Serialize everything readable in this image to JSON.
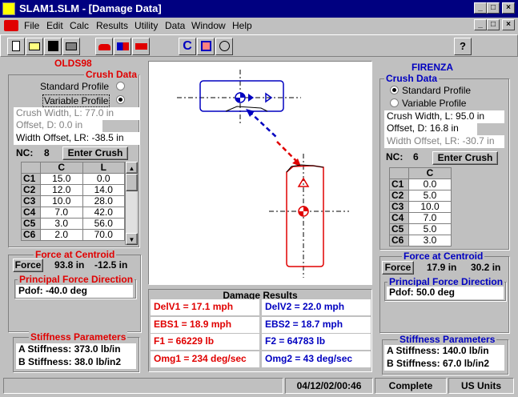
{
  "window": {
    "title": "SLAM1.SLM - [Damage Data]",
    "controls": {
      "minimize": "_",
      "maximize": "□",
      "close": "×"
    }
  },
  "menu": [
    "File",
    "Edit",
    "Calc",
    "Results",
    "Utility",
    "Data",
    "Window",
    "Help"
  ],
  "toolbar": {
    "crush_button": "C",
    "help_button": "?"
  },
  "left": {
    "vehicle": "OLDS98",
    "crush_data_title": "Crush Data",
    "standard_profile": "Standard Profile",
    "variable_profile": "Variable Profile",
    "selected_profile": "variable",
    "crush_width": "Crush Width, L:   77.0 in",
    "offset": "Offset, D:     0.0 in",
    "width_offset": "Width Offset, LR:  -38.5 in",
    "nc_label": "NC:",
    "nc_value": "8",
    "enter_crush": "Enter Crush",
    "table": {
      "headers": [
        "C",
        "L"
      ],
      "rows": [
        {
          "label": "C1",
          "c": "15.0",
          "l": "0.0"
        },
        {
          "label": "C2",
          "c": "12.0",
          "l": "14.0"
        },
        {
          "label": "C3",
          "c": "10.0",
          "l": "28.0"
        },
        {
          "label": "C4",
          "c": "7.0",
          "l": "42.0"
        },
        {
          "label": "C5",
          "c": "3.0",
          "l": "56.0"
        },
        {
          "label": "C6",
          "c": "2.0",
          "l": "70.0"
        }
      ]
    },
    "force_title": "Force at Centroid",
    "force_button": "Force",
    "force_x": "93.8 in",
    "force_y": "-12.5 in",
    "pdof_title": "Principal Force Direction",
    "pdof": "Pdof:  -40.0 deg",
    "stiffness_title": "Stiffness Parameters",
    "a_stiffness": "A Stiffness:  373.0 lb/in",
    "b_stiffness": "B Stiffness:   38.0 lb/in2"
  },
  "right": {
    "vehicle": "FIRENZA",
    "crush_data_title": "Crush Data",
    "standard_profile": "Standard Profile",
    "variable_profile": "Variable Profile",
    "selected_profile": "standard",
    "crush_width": "Crush Width, L:    95.0 in",
    "offset": "Offset, D:     16.8 in",
    "width_offset": "Width Offset, LR:  -30.7 in",
    "nc_label": "NC:",
    "nc_value": "6",
    "enter_crush": "Enter Crush",
    "table": {
      "headers": [
        "C"
      ],
      "rows": [
        {
          "label": "C1",
          "c": "0.0"
        },
        {
          "label": "C2",
          "c": "5.0"
        },
        {
          "label": "C3",
          "c": "10.0"
        },
        {
          "label": "C4",
          "c": "7.0"
        },
        {
          "label": "C5",
          "c": "5.0"
        },
        {
          "label": "C6",
          "c": "3.0"
        }
      ]
    },
    "force_title": "Force at Centroid",
    "force_button": "Force",
    "force_x": "17.9 in",
    "force_y": "30.2 in",
    "pdof_title": "Principal Force Direction",
    "pdof": "Pdof:   50.0 deg",
    "stiffness_title": "Stiffness Parameters",
    "a_stiffness": "A Stiffness:  140.0 lb/in",
    "b_stiffness": "B Stiffness:   67.0 lb/in2"
  },
  "results": {
    "title": "Damage Results",
    "delv1": "DelV1 = 17.1 mph",
    "delv2": "DelV2 = 22.0 mph",
    "ebs1": "EBS1 = 18.9 mph",
    "ebs2": "EBS2 = 18.7 mph",
    "f1": "F1 = 66229 lb",
    "f2": "F2 = 64783 lb",
    "omg1": "Omg1 = 234 deg/sec",
    "omg2": "Omg2 = 43 deg/sec"
  },
  "status": {
    "datetime": "04/12/02/00:46",
    "state": "Complete",
    "units": "US Units"
  },
  "colors": {
    "vehicle1": "#e00000",
    "vehicle2": "#0000c0",
    "titlebar": "#000080"
  }
}
